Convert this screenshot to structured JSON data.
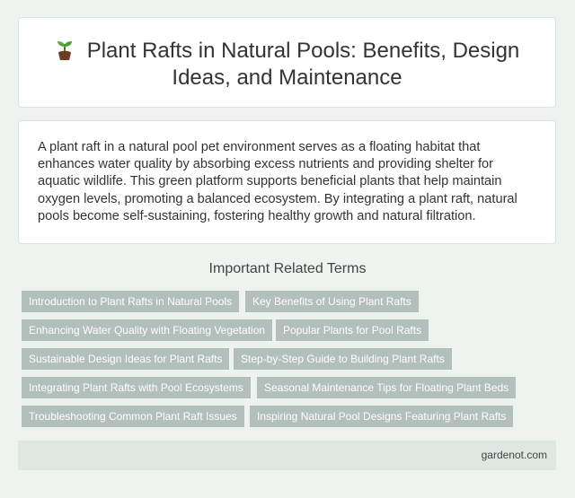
{
  "header": {
    "icon": "seedling-icon",
    "title": "Plant Rafts in Natural Pools: Benefits, Design Ideas, and Maintenance"
  },
  "description": "A plant raft in a natural pool pet environment serves as a floating habitat that enhances water quality by absorbing excess nutrients and providing shelter for aquatic wildlife. This green platform supports beneficial plants that help maintain oxygen levels, promoting a balanced ecosystem. By integrating a plant raft, natural pools become self-sustaining, fostering healthy growth and natural filtration.",
  "related": {
    "heading": "Important Related Terms",
    "terms": [
      "Introduction to Plant Rafts in Natural Pools",
      "Key Benefits of Using Plant Rafts",
      "Enhancing Water Quality with Floating Vegetation",
      "Popular Plants for Pool Rafts",
      "Sustainable Design Ideas for Plant Rafts",
      "Step-by-Step Guide to Building Plant Rafts",
      "Integrating Plant Rafts with Pool Ecosystems",
      "Seasonal Maintenance Tips for Floating Plant Beds",
      "Troubleshooting Common Plant Raft Issues",
      "Inspiring Natural Pool Designs Featuring Plant Rafts"
    ]
  },
  "footer": {
    "site": "gardenot.com"
  },
  "colors": {
    "background": "#eef3ef",
    "tag": "#b2bfbd",
    "footer": "#dfe7e2"
  }
}
